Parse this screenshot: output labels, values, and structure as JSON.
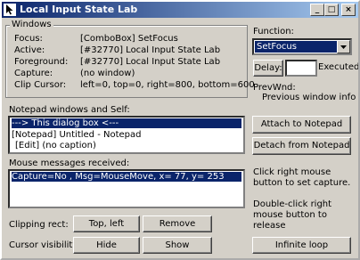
{
  "window": {
    "title": "Local Input State Lab"
  },
  "titlebar_buttons": {
    "minimize": "_",
    "maximize": "□",
    "close": "×"
  },
  "windows_group": {
    "title": "Windows",
    "rows": [
      {
        "label": "Focus:",
        "value": "[ComboBox] SetFocus"
      },
      {
        "label": "Active:",
        "value": "[#32770] Local Input State Lab"
      },
      {
        "label": "Foreground:",
        "value": "[#32770] Local Input State Lab"
      },
      {
        "label": "Capture:",
        "value": "(no window)"
      },
      {
        "label": "Clip Cursor:",
        "value": "left=0, top=0, right=800, bottom=600"
      }
    ]
  },
  "function_panel": {
    "label": "Function:",
    "selected": "SetFocus",
    "delay_button": "Delay:",
    "delay_value": "",
    "executed_label": "Executed",
    "prevwnd_label": "PrevWnd:",
    "prevwnd_value": "Previous window info"
  },
  "notepad_list": {
    "label": "Notepad windows and Self:",
    "items": [
      "---> This dialog box <---",
      "[Notepad] Untitled - Notepad",
      "  [Edit] (no caption)"
    ],
    "selected_index": 0
  },
  "buttons": {
    "attach": "Attach to Notepad",
    "detach": "Detach from Notepad",
    "top_left": "Top, left",
    "remove": "Remove",
    "hide": "Hide",
    "show": "Show",
    "infinite_loop": "Infinite loop"
  },
  "mouse_messages": {
    "label": "Mouse messages received:",
    "items": [
      "Capture=No , Msg=MouseMove,  x=   77, y=  253"
    ]
  },
  "hints": {
    "capture_hint": "Click right mouse button to set capture.",
    "release_hint": "Double-click right mouse button to release"
  },
  "labels": {
    "clipping_rect": "Clipping rect:",
    "cursor_visibility": "Cursor visibility:"
  },
  "colors": {
    "selection": "#0a246a",
    "face": "#d4d0c8"
  }
}
